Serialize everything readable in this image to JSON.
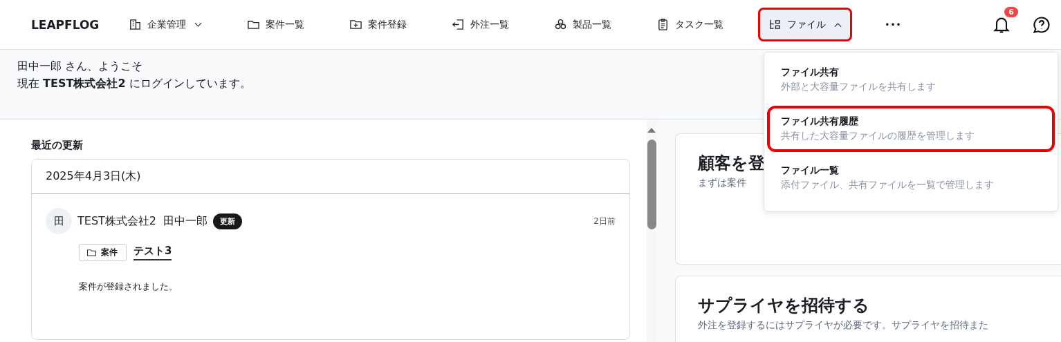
{
  "nav": {
    "logo": "LEAPFLOG",
    "items": [
      {
        "label": "企業管理",
        "has_menu": true,
        "open": false,
        "highlighted": false
      },
      {
        "label": "案件一覧",
        "has_menu": false,
        "open": false,
        "highlighted": false
      },
      {
        "label": "案件登録",
        "has_menu": false,
        "open": false,
        "highlighted": false
      },
      {
        "label": "外注一覧",
        "has_menu": false,
        "open": false,
        "highlighted": false
      },
      {
        "label": "製品一覧",
        "has_menu": false,
        "open": false,
        "highlighted": false
      },
      {
        "label": "タスク一覧",
        "has_menu": false,
        "open": false,
        "highlighted": false
      },
      {
        "label": "ファイル",
        "has_menu": true,
        "open": true,
        "highlighted": true
      }
    ],
    "more": "•••",
    "notification_count": "6"
  },
  "dropdown": {
    "items": [
      {
        "title": "ファイル共有",
        "description": "外部と大容量ファイルを共有します",
        "highlighted": false
      },
      {
        "title": "ファイル共有履歴",
        "description": "共有した大容量ファイルの履歴を管理します",
        "highlighted": true
      },
      {
        "title": "ファイル一覧",
        "description": "添付ファイル、共有ファイルを一覧で管理します",
        "highlighted": false
      }
    ]
  },
  "welcome": {
    "line_1": "田中一郎 さん、ようこそ",
    "line_2": "現在 **TEST株式会社2** にログインしています。"
  },
  "recent_updates": {
    "title": "最近の更新",
    "date": "2025年4月3日(木)",
    "entries": [
      {
        "avatar": "田",
        "author": "TEST株式会社2  田中一郎",
        "badge": "更新",
        "time": "2日前",
        "tag": "案件",
        "link": "テスト3",
        "message": "案件が登録されました。"
      }
    ]
  },
  "cards": [
    {
      "title": "顧客を登",
      "description": "まずは案件"
    },
    {
      "title": "サプライヤを招待する",
      "description": "外注を登録するにはサプライヤが必要です。サプライヤを招待また"
    }
  ]
}
